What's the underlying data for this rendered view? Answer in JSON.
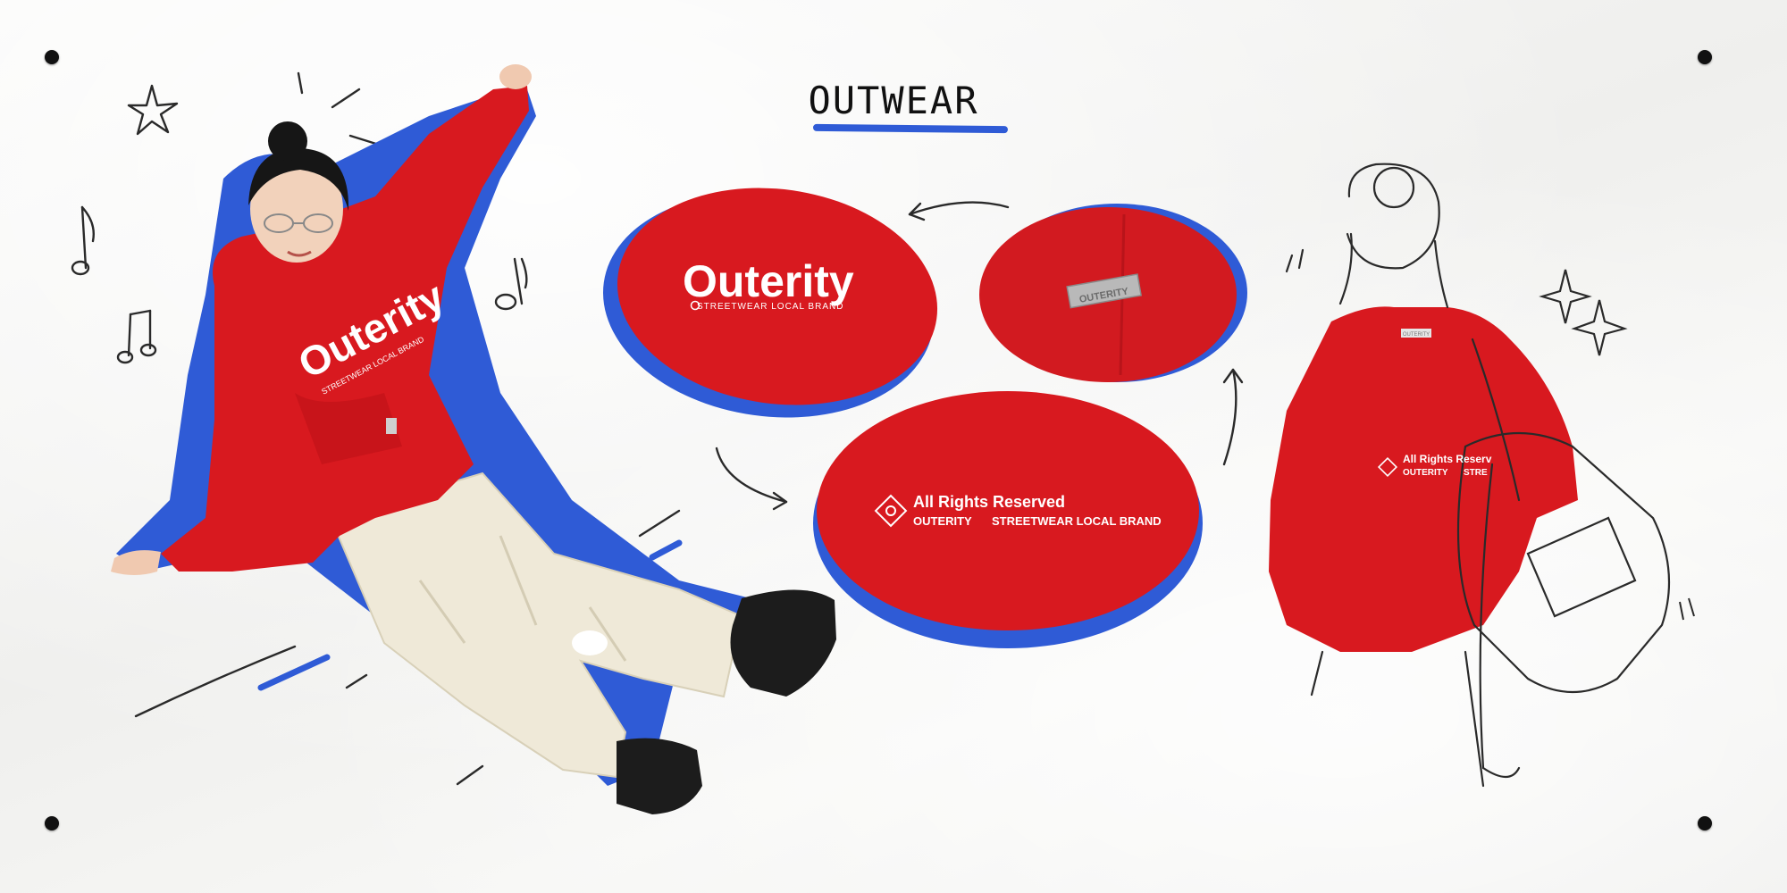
{
  "page": {
    "title": "OUTWEAR"
  },
  "colors": {
    "brand_red": "#d8191f",
    "accent_blue": "#2f5bd6",
    "ink": "#222222",
    "cream_pants": "#efe9d8"
  },
  "ovals": {
    "logo_closeup": {
      "brand": "Outerity",
      "tagline": "STREETWEAR LOCAL BRAND"
    },
    "label_closeup": {
      "tag_text": "OUTERITY"
    },
    "back_print": {
      "line1": "All Rights Reserved",
      "line2": "OUTERITY",
      "line3": "STREETWEAR LOCAL BRAND"
    }
  },
  "model_hoodie": {
    "brand": "Outerity",
    "tagline": "STREETWEAR LOCAL BRAND"
  },
  "sketch": {
    "tag_text": "OUTERITY",
    "print_line1": "All Rights Reserv",
    "print_line2": "OUTERITY",
    "print_line3": "STRE"
  },
  "icons": [
    "star-doodle-icon",
    "music-note-icon",
    "sparkle-icon",
    "arrow-icon"
  ]
}
